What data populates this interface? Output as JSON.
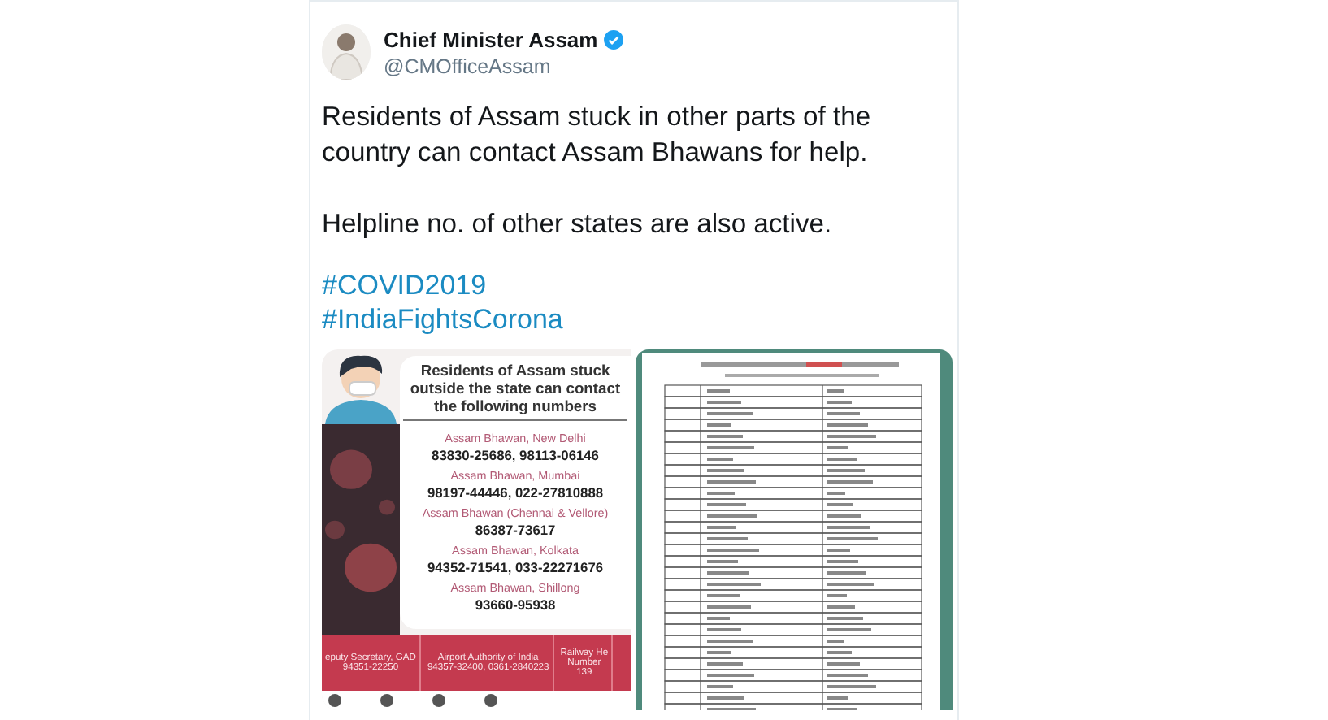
{
  "tweet": {
    "author": {
      "name": "Chief Minister Assam",
      "verified": true,
      "handle": "@CMOfficeAssam"
    },
    "paragraphs": [
      "Residents of Assam stuck in other parts of the country can contact Assam Bhawans for help.",
      "Helpline no. of other states are also active."
    ],
    "hashtags": [
      "#COVID2019",
      "#IndiaFightsCorona"
    ],
    "poster": {
      "headline": "Residents of Assam stuck outside the state can contact the following numbers",
      "contacts": [
        {
          "place": "Assam Bhawan, New Delhi",
          "numbers": "83830-25686, 98113-06146"
        },
        {
          "place": "Assam Bhawan, Mumbai",
          "numbers": "98197-44446, 022-27810888"
        },
        {
          "place": "Assam Bhawan (Chennai & Vellore)",
          "numbers": "86387-73617"
        },
        {
          "place": "Assam Bhawan, Kolkata",
          "numbers": "94352-71541, 033-22271676"
        },
        {
          "place": "Assam Bhawan, Shillong",
          "numbers": "93660-95938"
        }
      ],
      "footer": [
        {
          "lines": [
            "eputy Secretary, GAD",
            "94351-22250"
          ]
        },
        {
          "lines": [
            "Airport Authority of India",
            "94357-32400, 0361-2840223"
          ]
        },
        {
          "lines": [
            "Railway He",
            "Number",
            "139"
          ]
        }
      ]
    }
  }
}
